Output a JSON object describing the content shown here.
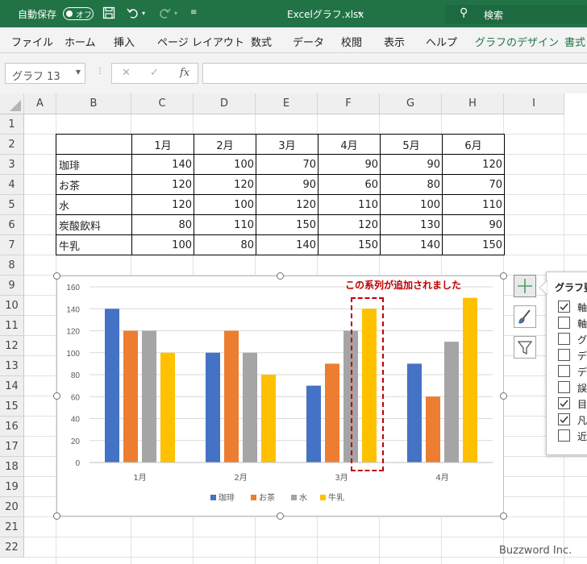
{
  "titlebar": {
    "autosave_label": "自動保存",
    "autosave_state": "オフ",
    "filename": "Excelグラフ.xlsx",
    "search_label": "検索"
  },
  "ribbon": {
    "tabs": [
      "ファイル",
      "ホーム",
      "挿入",
      "ページ レイアウト",
      "数式",
      "データ",
      "校閲",
      "表示",
      "ヘルプ",
      "グラフのデザイン",
      "書式"
    ]
  },
  "formula_bar": {
    "name_box": "グラフ 13",
    "fx_label": "fx",
    "value": ""
  },
  "grid": {
    "columns": [
      "A",
      "B",
      "C",
      "D",
      "E",
      "F",
      "G",
      "H",
      "I"
    ],
    "rows": [
      "1",
      "2",
      "3",
      "4",
      "5",
      "6",
      "7",
      "8",
      "9",
      "10",
      "11",
      "12",
      "13",
      "14",
      "15",
      "16",
      "17",
      "18",
      "19",
      "20",
      "21",
      "22"
    ]
  },
  "table": {
    "headers": [
      "",
      "1月",
      "2月",
      "3月",
      "4月",
      "5月",
      "6月"
    ],
    "rows": [
      {
        "label": "珈琲",
        "values": [
          "140",
          "100",
          "70",
          "90",
          "90",
          "120"
        ]
      },
      {
        "label": "お茶",
        "values": [
          "120",
          "120",
          "90",
          "60",
          "80",
          "70"
        ]
      },
      {
        "label": "水",
        "values": [
          "120",
          "100",
          "120",
          "110",
          "100",
          "110"
        ]
      },
      {
        "label": "炭酸飲料",
        "values": [
          "80",
          "110",
          "150",
          "120",
          "130",
          "90"
        ]
      },
      {
        "label": "牛乳",
        "values": [
          "100",
          "80",
          "140",
          "150",
          "140",
          "150"
        ]
      }
    ]
  },
  "annotation": "この系列が追加されました",
  "chart_flyout": {
    "title": "グラフ要",
    "items": [
      {
        "label": "軸",
        "checked": true
      },
      {
        "label": "軸",
        "checked": false
      },
      {
        "label": "グ",
        "checked": false
      },
      {
        "label": "デ",
        "checked": false
      },
      {
        "label": "デ",
        "checked": false
      },
      {
        "label": "誤",
        "checked": false
      },
      {
        "label": "目",
        "checked": true
      },
      {
        "label": "凡",
        "checked": true
      },
      {
        "label": "近",
        "checked": false
      }
    ]
  },
  "watermark": "Buzzword Inc.",
  "chart_data": {
    "type": "bar",
    "categories": [
      "1月",
      "2月",
      "3月",
      "4月"
    ],
    "series": [
      {
        "name": "珈琲",
        "values": [
          140,
          100,
          70,
          90
        ],
        "color": "#4472c4"
      },
      {
        "name": "お茶",
        "values": [
          120,
          120,
          90,
          60
        ],
        "color": "#ed7d31"
      },
      {
        "name": "水",
        "values": [
          120,
          100,
          120,
          110
        ],
        "color": "#a5a5a5"
      },
      {
        "name": "牛乳",
        "values": [
          100,
          80,
          140,
          150
        ],
        "color": "#ffc000"
      }
    ],
    "ylim": [
      0,
      160
    ],
    "yticks": [
      0,
      20,
      40,
      60,
      80,
      100,
      120,
      140,
      160
    ],
    "title": "",
    "xlabel": "",
    "ylabel": "",
    "legend": "bottom",
    "grid": true
  }
}
